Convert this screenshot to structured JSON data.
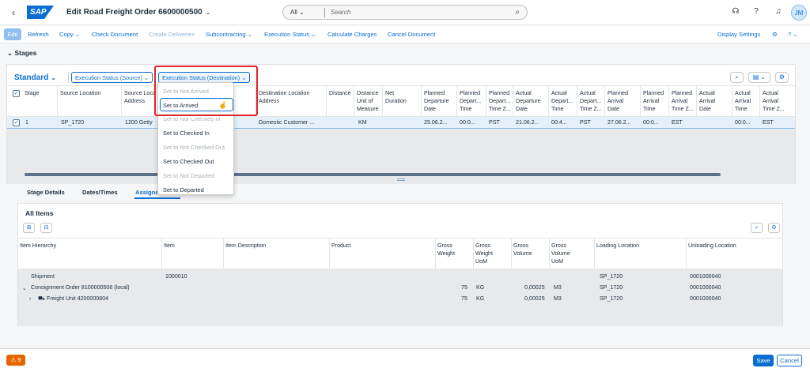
{
  "shell": {
    "title": "Edit Road Freight Order 6600000500",
    "search_scope": "All",
    "search_placeholder": "Search",
    "avatar": "JM",
    "logo": "SAP"
  },
  "toolbar": {
    "edit": "Edit",
    "refresh": "Refresh",
    "copy": "Copy",
    "check": "Check Document",
    "create_deliveries": "Create Deliveries",
    "subcontracting": "Subcontracting",
    "exec_status": "Execution Status",
    "calc": "Calculate Charges",
    "cancel_doc": "Cancel Document",
    "display_settings": "Display Settings"
  },
  "section": {
    "title": "Stages"
  },
  "stages": {
    "variant": "Standard",
    "filter_source": "Execution Status (Source)",
    "filter_dest": "Execution Status (Destination)",
    "headers": [
      "Stage",
      "Source Location",
      "Source Location Address",
      "Destination Location",
      "Destination Location Address",
      "Distance",
      "Distance Unit of Measure",
      "Net Duration",
      "Planned Departure Date",
      "Planned Departure Time",
      "Planned Departure Time Zone",
      "Actual Departure Date",
      "Actual Departure Time",
      "Actual Departure Time Zone",
      "Planned Arrival Date",
      "Planned Arrival Time",
      "Planned Arrival Time Zone",
      "Actual Arrival Date",
      "Actual Arrival Time",
      "Actual Arrival Time Zone"
    ],
    "headers_display": [
      "Stage",
      "Source Location",
      "Source Loca\nAddress",
      "",
      "Destination Location\nAddress",
      "Distance",
      "Distance\nUnit of\nMeasure",
      "Net\nDuration",
      "Planned\nDeparture\nDate",
      "Planned\nDepart...\nTime",
      "Planned\nDepart...\nTime Z...",
      "Actual\nDeparture\nDate",
      "Actual\nDepart...\nTime",
      "Actual\nDepart...\nTime Z...",
      "Planned\nArrival\nDate",
      "Planned\nArrival\nTime",
      "Planned\nArrival\nTime Z...",
      "Actual\nArrival\nDate",
      "Actual\nArrival\nTime",
      "Actual\nArrival\nTime Z..."
    ],
    "row": {
      "stage": "1",
      "source": "SP_1720",
      "source_addr": "1200 Getty",
      "dest_addr": "Domestic Customer ...",
      "uom": "KM",
      "pdep_date": "25.06.2...",
      "pdep_time": "00:0...",
      "pdep_tz": "PST",
      "adep_date": "21.06.2...",
      "adep_time": "00:4...",
      "adep_tz": "PST",
      "parr_date": "27.06.2...",
      "parr_time": "00:0...",
      "parr_tz": "EST",
      "aarr_time": "00:0...",
      "aarr_tz": "EST"
    }
  },
  "menu": {
    "items": [
      "Set to Not Arrived",
      "Set to Arrived",
      "Set to Not Checked In",
      "Set to Checked In",
      "Set to Not Checked Out",
      "Set to Checked Out",
      "Set to Not Departed",
      "Set to Departed"
    ]
  },
  "tabs": [
    "Stage Details",
    "Dates/Times",
    "Assigne"
  ],
  "items": {
    "title": "All Items",
    "headers": [
      "Item Hierarchy",
      "Item",
      "Item Description",
      "Product",
      "Gross\nWeight",
      "Gross\nWeight\nUoM",
      "Gross\nVolume",
      "Gross\nVolume\nUoM",
      "Loading Location",
      "Unloading Location"
    ],
    "rows": [
      {
        "h": "Shipment",
        "item": "1000010",
        "gw": "",
        "gwu": "",
        "gv": "",
        "gvu": "",
        "load": "SP_1720",
        "unload": "0001000040"
      },
      {
        "h": "Consignment Order 8100000506 (local)",
        "item": "",
        "gw": "75",
        "gwu": "KG",
        "gv": "0,00025",
        "gvu": "M3",
        "load": "SP_1720",
        "unload": "0001000040"
      },
      {
        "h": "Freight Unit 4200000804",
        "item": "",
        "gw": "75",
        "gwu": "KG",
        "gv": "0,00025",
        "gvu": "M3",
        "load": "SP_1720",
        "unload": "0001000040"
      }
    ]
  },
  "footer": {
    "warnings": "9",
    "save": "Save",
    "cancel": "Cancel"
  },
  "colors": {
    "accent": "#0a6ed1",
    "warning": "#e76500",
    "highlight": "#e3232a"
  }
}
